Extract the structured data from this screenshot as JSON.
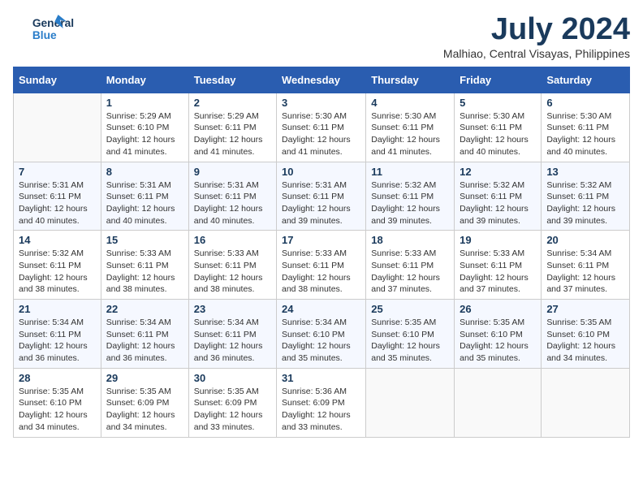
{
  "header": {
    "logo_line1": "General",
    "logo_line2": "Blue",
    "month_title": "July 2024",
    "location": "Malhiao, Central Visayas, Philippines"
  },
  "weekdays": [
    "Sunday",
    "Monday",
    "Tuesday",
    "Wednesday",
    "Thursday",
    "Friday",
    "Saturday"
  ],
  "weeks": [
    [
      {
        "day": "",
        "sunrise": "",
        "sunset": "",
        "daylight": ""
      },
      {
        "day": "1",
        "sunrise": "Sunrise: 5:29 AM",
        "sunset": "Sunset: 6:10 PM",
        "daylight": "Daylight: 12 hours and 41 minutes."
      },
      {
        "day": "2",
        "sunrise": "Sunrise: 5:29 AM",
        "sunset": "Sunset: 6:11 PM",
        "daylight": "Daylight: 12 hours and 41 minutes."
      },
      {
        "day": "3",
        "sunrise": "Sunrise: 5:30 AM",
        "sunset": "Sunset: 6:11 PM",
        "daylight": "Daylight: 12 hours and 41 minutes."
      },
      {
        "day": "4",
        "sunrise": "Sunrise: 5:30 AM",
        "sunset": "Sunset: 6:11 PM",
        "daylight": "Daylight: 12 hours and 41 minutes."
      },
      {
        "day": "5",
        "sunrise": "Sunrise: 5:30 AM",
        "sunset": "Sunset: 6:11 PM",
        "daylight": "Daylight: 12 hours and 40 minutes."
      },
      {
        "day": "6",
        "sunrise": "Sunrise: 5:30 AM",
        "sunset": "Sunset: 6:11 PM",
        "daylight": "Daylight: 12 hours and 40 minutes."
      }
    ],
    [
      {
        "day": "7",
        "sunrise": "Sunrise: 5:31 AM",
        "sunset": "Sunset: 6:11 PM",
        "daylight": "Daylight: 12 hours and 40 minutes."
      },
      {
        "day": "8",
        "sunrise": "Sunrise: 5:31 AM",
        "sunset": "Sunset: 6:11 PM",
        "daylight": "Daylight: 12 hours and 40 minutes."
      },
      {
        "day": "9",
        "sunrise": "Sunrise: 5:31 AM",
        "sunset": "Sunset: 6:11 PM",
        "daylight": "Daylight: 12 hours and 40 minutes."
      },
      {
        "day": "10",
        "sunrise": "Sunrise: 5:31 AM",
        "sunset": "Sunset: 6:11 PM",
        "daylight": "Daylight: 12 hours and 39 minutes."
      },
      {
        "day": "11",
        "sunrise": "Sunrise: 5:32 AM",
        "sunset": "Sunset: 6:11 PM",
        "daylight": "Daylight: 12 hours and 39 minutes."
      },
      {
        "day": "12",
        "sunrise": "Sunrise: 5:32 AM",
        "sunset": "Sunset: 6:11 PM",
        "daylight": "Daylight: 12 hours and 39 minutes."
      },
      {
        "day": "13",
        "sunrise": "Sunrise: 5:32 AM",
        "sunset": "Sunset: 6:11 PM",
        "daylight": "Daylight: 12 hours and 39 minutes."
      }
    ],
    [
      {
        "day": "14",
        "sunrise": "Sunrise: 5:32 AM",
        "sunset": "Sunset: 6:11 PM",
        "daylight": "Daylight: 12 hours and 38 minutes."
      },
      {
        "day": "15",
        "sunrise": "Sunrise: 5:33 AM",
        "sunset": "Sunset: 6:11 PM",
        "daylight": "Daylight: 12 hours and 38 minutes."
      },
      {
        "day": "16",
        "sunrise": "Sunrise: 5:33 AM",
        "sunset": "Sunset: 6:11 PM",
        "daylight": "Daylight: 12 hours and 38 minutes."
      },
      {
        "day": "17",
        "sunrise": "Sunrise: 5:33 AM",
        "sunset": "Sunset: 6:11 PM",
        "daylight": "Daylight: 12 hours and 38 minutes."
      },
      {
        "day": "18",
        "sunrise": "Sunrise: 5:33 AM",
        "sunset": "Sunset: 6:11 PM",
        "daylight": "Daylight: 12 hours and 37 minutes."
      },
      {
        "day": "19",
        "sunrise": "Sunrise: 5:33 AM",
        "sunset": "Sunset: 6:11 PM",
        "daylight": "Daylight: 12 hours and 37 minutes."
      },
      {
        "day": "20",
        "sunrise": "Sunrise: 5:34 AM",
        "sunset": "Sunset: 6:11 PM",
        "daylight": "Daylight: 12 hours and 37 minutes."
      }
    ],
    [
      {
        "day": "21",
        "sunrise": "Sunrise: 5:34 AM",
        "sunset": "Sunset: 6:11 PM",
        "daylight": "Daylight: 12 hours and 36 minutes."
      },
      {
        "day": "22",
        "sunrise": "Sunrise: 5:34 AM",
        "sunset": "Sunset: 6:11 PM",
        "daylight": "Daylight: 12 hours and 36 minutes."
      },
      {
        "day": "23",
        "sunrise": "Sunrise: 5:34 AM",
        "sunset": "Sunset: 6:11 PM",
        "daylight": "Daylight: 12 hours and 36 minutes."
      },
      {
        "day": "24",
        "sunrise": "Sunrise: 5:34 AM",
        "sunset": "Sunset: 6:10 PM",
        "daylight": "Daylight: 12 hours and 35 minutes."
      },
      {
        "day": "25",
        "sunrise": "Sunrise: 5:35 AM",
        "sunset": "Sunset: 6:10 PM",
        "daylight": "Daylight: 12 hours and 35 minutes."
      },
      {
        "day": "26",
        "sunrise": "Sunrise: 5:35 AM",
        "sunset": "Sunset: 6:10 PM",
        "daylight": "Daylight: 12 hours and 35 minutes."
      },
      {
        "day": "27",
        "sunrise": "Sunrise: 5:35 AM",
        "sunset": "Sunset: 6:10 PM",
        "daylight": "Daylight: 12 hours and 34 minutes."
      }
    ],
    [
      {
        "day": "28",
        "sunrise": "Sunrise: 5:35 AM",
        "sunset": "Sunset: 6:10 PM",
        "daylight": "Daylight: 12 hours and 34 minutes."
      },
      {
        "day": "29",
        "sunrise": "Sunrise: 5:35 AM",
        "sunset": "Sunset: 6:09 PM",
        "daylight": "Daylight: 12 hours and 34 minutes."
      },
      {
        "day": "30",
        "sunrise": "Sunrise: 5:35 AM",
        "sunset": "Sunset: 6:09 PM",
        "daylight": "Daylight: 12 hours and 33 minutes."
      },
      {
        "day": "31",
        "sunrise": "Sunrise: 5:36 AM",
        "sunset": "Sunset: 6:09 PM",
        "daylight": "Daylight: 12 hours and 33 minutes."
      },
      {
        "day": "",
        "sunrise": "",
        "sunset": "",
        "daylight": ""
      },
      {
        "day": "",
        "sunrise": "",
        "sunset": "",
        "daylight": ""
      },
      {
        "day": "",
        "sunrise": "",
        "sunset": "",
        "daylight": ""
      }
    ]
  ]
}
